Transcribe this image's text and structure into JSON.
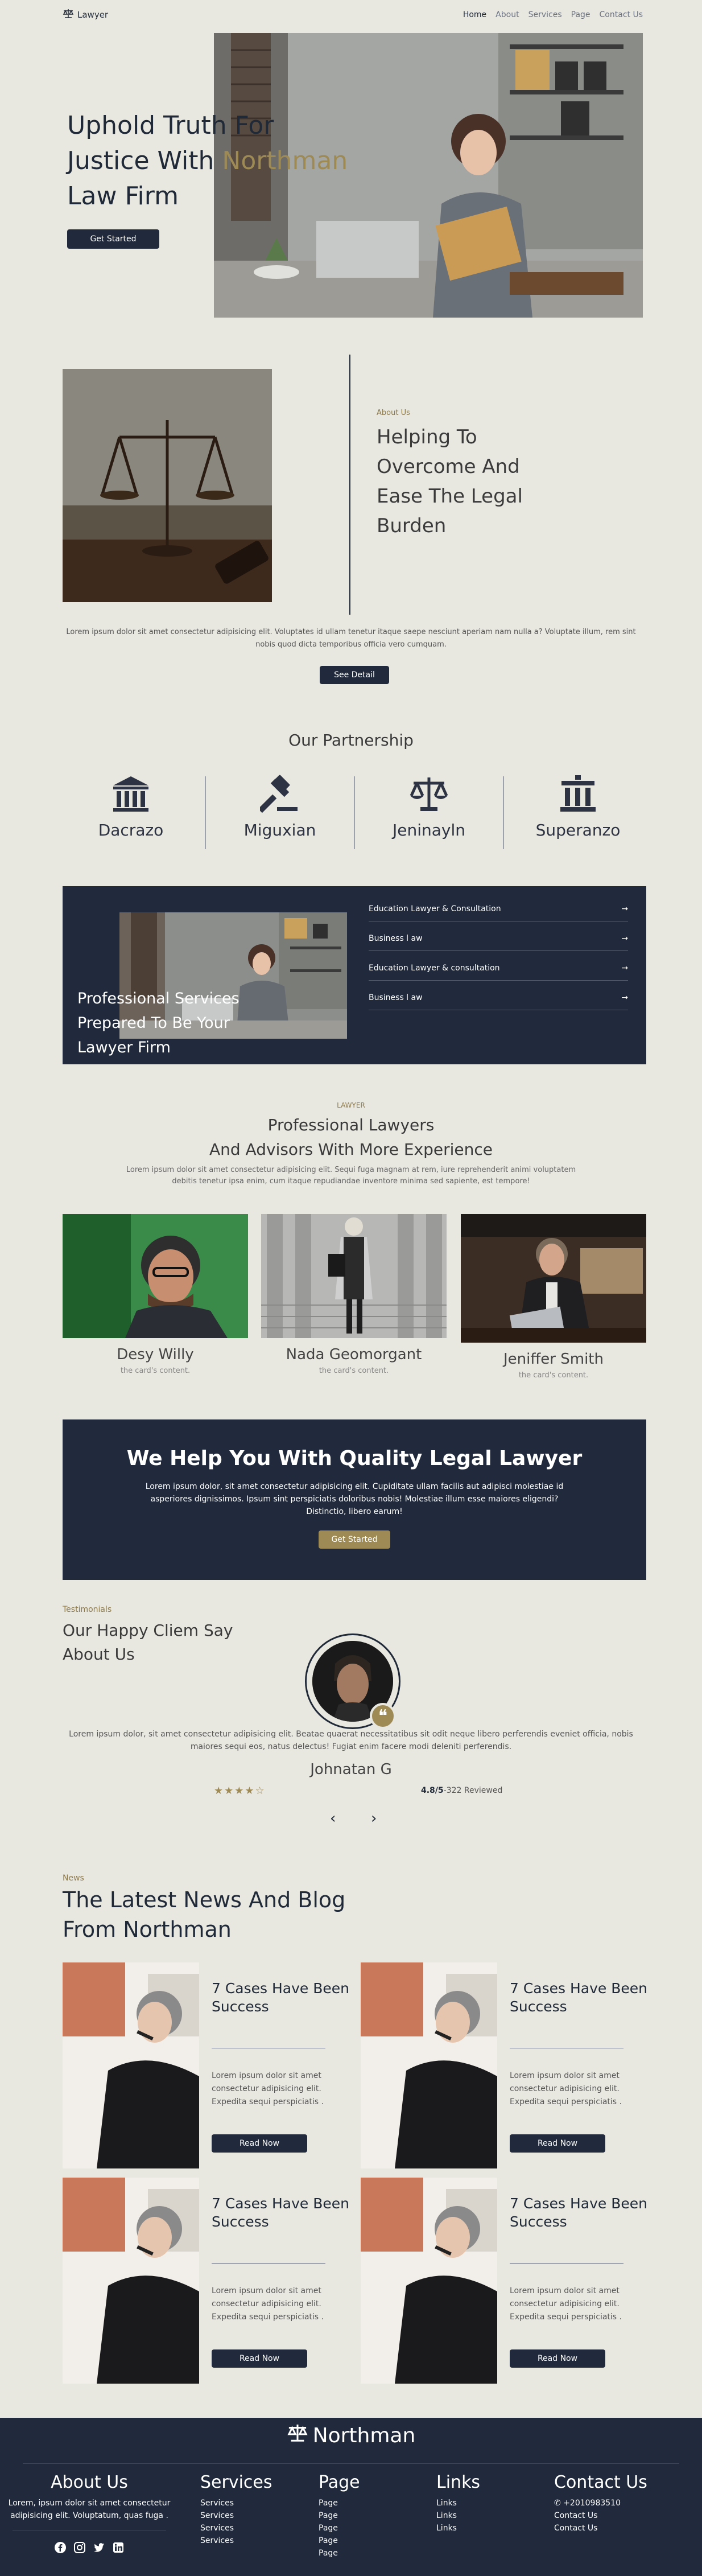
{
  "header": {
    "logo_text": "Lawyer",
    "nav": [
      "Home",
      "About",
      "Services",
      "Page",
      "Contact Us"
    ]
  },
  "hero": {
    "title_line1": "Uphold Truth For",
    "title_line2_a": "Justice With",
    "title_line2_b": "Northman",
    "title_line3": "Law Firm",
    "button": "Get Started"
  },
  "about": {
    "tag": "About Us",
    "title": "Helping To Overcome And Ease The Legal Burden",
    "text": "Lorem ipsum dolor sit amet consectetur adipisicing elit. Voluptates id ullam tenetur itaque saepe nesciunt aperiam nam nulla a? Voluptate illum, rem sint nobis quod dicta temporibus officia vero cumquam.",
    "button": "See Detail"
  },
  "partnership": {
    "title": "Our Partnership",
    "items": [
      "Dacrazo",
      "Miguxian",
      "Jeninayln",
      "Superanzo"
    ]
  },
  "services": {
    "title": "Professional Services Prepared To Be Your Lawyer Firm",
    "items": [
      "Education Lawyer & Consultation",
      "Business l aw",
      "Education Lawyer & consultation",
      "Business l aw"
    ]
  },
  "lawyers": {
    "tag": "LAWYER",
    "title_line1": "Professional Lawyers",
    "title_line2": "And Advisors With More Experience",
    "text": "Lorem ipsum dolor sit amet consectetur adipisicing elit. Sequi fuga magnam at rem, iure reprehenderit animi voluptatem debitis tenetur ipsa enim, cum itaque repudiandae inventore minima sed sapiente, est tempore!",
    "cards": [
      {
        "name": "Desy Willy",
        "sub": "the card's content."
      },
      {
        "name": "Nada Geomorgant",
        "sub": "the card's content."
      },
      {
        "name": "Jeniffer Smith",
        "sub": "the card's content."
      }
    ]
  },
  "quality": {
    "title": "We Help You With Quality Legal Lawyer",
    "text": "Lorem ipsum dolor, sit amet consectetur adipisicing elit. Cupiditate ullam facilis aut adipisci molestiae id asperiores dignissimos. Ipsum sint perspiciatis doloribus nobis! Molestiae illum esse maiores eligendi? Distinctio, libero earum!",
    "button": "Get Started"
  },
  "testimonials": {
    "tag": "Testimonials",
    "title": "Our Happy Cliem Say About Us",
    "text": "Lorem ipsum dolor, sit amet consectetur adipisicing elit. Beatae quaerat necessitatibus sit odit neque libero perferendis eveniet officia, nobis maiores sequi eos, natus delectus! Fugiat enim facere modi deleniti perferendis.",
    "name": "Johnatan G",
    "stars": "★★★★☆",
    "rating_value": "4.8/5",
    "rating_count": "-322 Reviewed"
  },
  "news": {
    "tag": "News",
    "title": "The Latest News And Blog From Northman",
    "cards": [
      {
        "title": "7 Cases Have Been Success",
        "text": "Lorem ipsum dolor sit amet consectetur adipisicing elit. Expedita sequi perspiciatis .",
        "button": "Read Now"
      },
      {
        "title": "7 Cases Have Been Success",
        "text": "Lorem ipsum dolor sit amet consectetur adipisicing elit. Expedita sequi perspiciatis .",
        "button": "Read Now"
      },
      {
        "title": "7 Cases Have Been Success",
        "text": "Lorem ipsum dolor sit amet consectetur adipisicing elit. Expedita sequi perspiciatis .",
        "button": "Read Now"
      },
      {
        "title": "7 Cases Have Been Success",
        "text": "Lorem ipsum dolor sit amet consectetur adipisicing elit. Expedita sequi perspiciatis .",
        "button": "Read Now"
      }
    ]
  },
  "footer": {
    "logo_text": "Northman",
    "about_title": "About Us",
    "about_text": "Lorem, ipsum dolor sit amet consectetur adipisicing elit. Voluptatum, quas fuga .",
    "services_title": "Services",
    "services": [
      "Services",
      "Services",
      "Services",
      "Services"
    ],
    "page_title": "Page",
    "pages": [
      "Page",
      "Page",
      "Page",
      "Page",
      "Page"
    ],
    "links_title": "Links",
    "links": [
      "Links",
      "Links",
      "Links"
    ],
    "contact_title": "Contact Us",
    "contact": [
      "+2010983510",
      "Contact Us",
      "Contact Us"
    ]
  },
  "colors": {
    "navy": "#202a3c",
    "gold": "#9e8a55",
    "background": "#e8e7e0"
  }
}
